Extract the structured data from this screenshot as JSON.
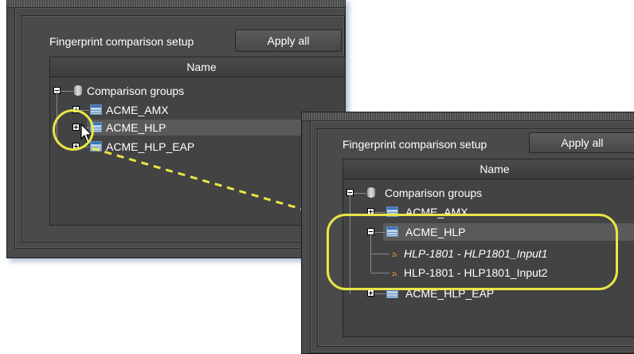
{
  "back_panel": {
    "setup_label": "Fingerprint comparison setup",
    "apply_button": "Apply all",
    "column_header": "Name",
    "root": "Comparison groups",
    "groups": [
      "ACME_AMX",
      "ACME_HLP",
      "ACME_HLP_EAP"
    ]
  },
  "front_panel": {
    "setup_label": "Fingerprint comparison setup",
    "apply_button": "Apply all",
    "column_header": "Name",
    "root": "Comparison groups",
    "groups": [
      "ACME_AMX",
      "ACME_HLP",
      "ACME_HLP_EAP"
    ],
    "children": [
      "HLP-1801 - HLP1801_Input1",
      "HLP-1801 - HLP1801_Input2"
    ]
  },
  "colors": {
    "callout": "#e8e646",
    "panel": "#4a4a4a",
    "feed_icon": "#ff9a2b"
  }
}
